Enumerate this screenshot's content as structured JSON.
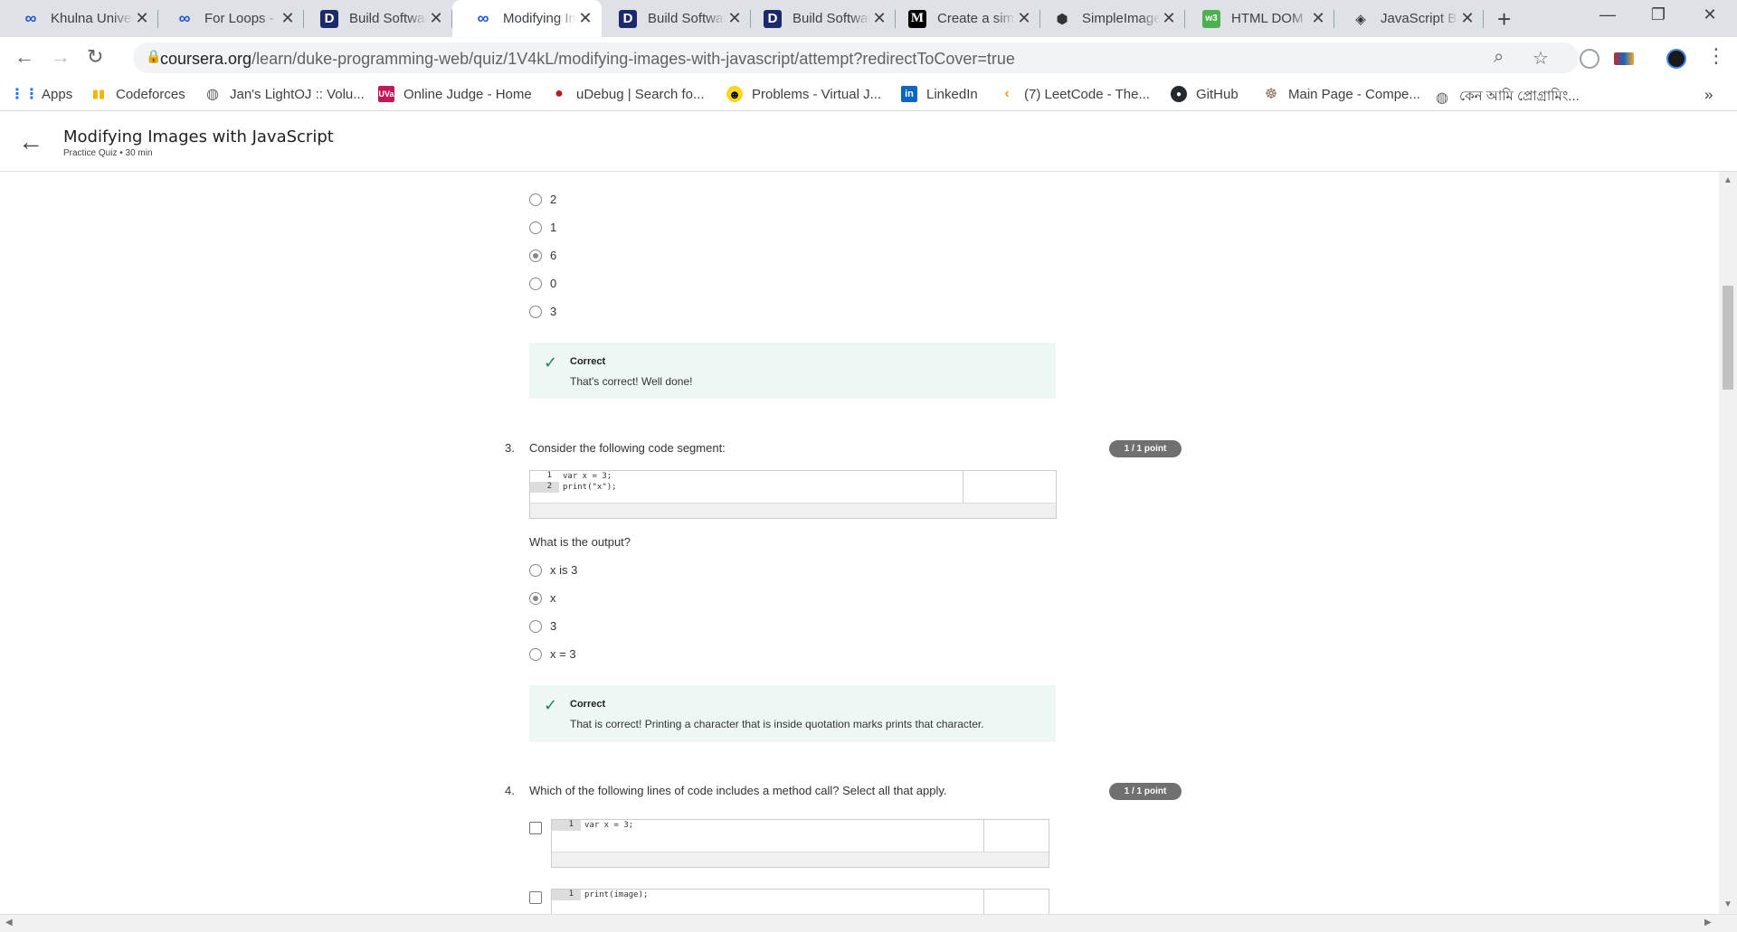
{
  "browser": {
    "tabs": [
      {
        "title": "Khulna University",
        "icon": "coursera-infinity-icon"
      },
      {
        "title": "For Loops - Coursera",
        "icon": "coursera-infinity-icon"
      },
      {
        "title": "Build Software",
        "icon": "duke-icon"
      },
      {
        "title": "Modifying Images",
        "icon": "coursera-infinity-icon"
      },
      {
        "title": "Build Software",
        "icon": "duke-icon"
      },
      {
        "title": "Build Software",
        "icon": "duke-icon"
      },
      {
        "title": "Create a simple",
        "icon": "medium-icon"
      },
      {
        "title": "SimpleImage",
        "icon": "simpleimage-icon"
      },
      {
        "title": "HTML DOM",
        "icon": "w3schools-icon"
      },
      {
        "title": "JavaScript Basics",
        "icon": "diamond-icon"
      }
    ],
    "active_tab": 3,
    "url_host": "coursera.org",
    "url_path": "/learn/duke-programming-web/quiz/1V4kL/modifying-images-with-javascript/attempt?redirectToCover=true",
    "bookmarks": [
      {
        "label": "Apps",
        "icon": "apps-grid-icon"
      },
      {
        "label": "Codeforces",
        "icon": "codeforces-icon"
      },
      {
        "label": "Jan's LightOJ :: Volu...",
        "icon": "globe-icon"
      },
      {
        "label": "Online Judge - Home",
        "icon": "uva-icon"
      },
      {
        "label": "uDebug | Search fo...",
        "icon": "udebug-icon"
      },
      {
        "label": "Problems - Virtual J...",
        "icon": "vjudge-icon"
      },
      {
        "label": "LinkedIn",
        "icon": "linkedin-icon"
      },
      {
        "label": "(7) LeetCode - The...",
        "icon": "leetcode-icon"
      },
      {
        "label": "GitHub",
        "icon": "github-icon"
      },
      {
        "label": "Main Page - Compe...",
        "icon": "cp-algorithms-icon"
      },
      {
        "label": "কেন আমি প্রোগ্রামিং...",
        "icon": "globe-icon"
      }
    ],
    "bookmarks_overflow": "»"
  },
  "page": {
    "title": "Modifying Images with JavaScript",
    "subtitle": "Practice Quiz • 30 min"
  },
  "quiz": {
    "q2": {
      "options": [
        "2",
        "1",
        "6",
        "0",
        "3"
      ],
      "selected": 2,
      "feedback_label": "Correct",
      "feedback": "That's correct! Well done!"
    },
    "q3": {
      "number": "3.",
      "prompt": "Consider the following code segment:",
      "points": "1 / 1 point",
      "code_lines": [
        {
          "n": "1",
          "text": "var x = 3;"
        },
        {
          "n": "2",
          "text": "print(\"x\");"
        }
      ],
      "question": "What is the output?",
      "options": [
        "x is 3",
        "x",
        "3",
        "x = 3"
      ],
      "selected": 1,
      "feedback_label": "Correct",
      "feedback": "That is correct! Printing a character that is inside quotation marks prints that character."
    },
    "q4": {
      "number": "4.",
      "prompt": "Which of the following lines of code includes a method call? Select all that apply.",
      "points": "1 / 1 point",
      "choices": [
        {
          "n": "1",
          "code": "var x = 3;"
        },
        {
          "n": "1",
          "code": "print(image);"
        }
      ]
    }
  }
}
